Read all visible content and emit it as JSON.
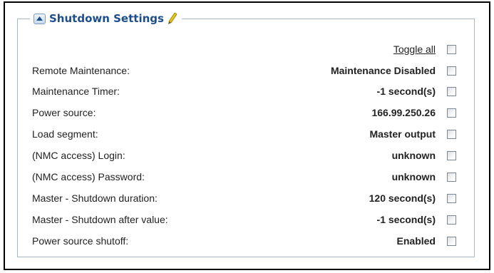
{
  "panel": {
    "title": "Shutdown Settings",
    "collapse_icon": "triangle-up-icon",
    "edit_icon": "pencil-icon"
  },
  "toggle_all_label": "Toggle all",
  "settings": [
    {
      "label": "Remote Maintenance:",
      "value": "Maintenance Disabled"
    },
    {
      "label": "Maintenance Timer:",
      "value": "-1 second(s)"
    },
    {
      "label": "Power source:",
      "value": "166.99.250.26"
    },
    {
      "label": "Load segment:",
      "value": "Master output"
    },
    {
      "label": "(NMC access) Login:",
      "value": "unknown"
    },
    {
      "label": "(NMC access) Password:",
      "value": "unknown"
    },
    {
      "label": "Master - Shutdown duration:",
      "value": "120 second(s)"
    },
    {
      "label": "Master - Shutdown after value:",
      "value": "-1 second(s)"
    },
    {
      "label": "Power source shutoff:",
      "value": "Enabled"
    }
  ],
  "colors": {
    "title": "#1c4e8c",
    "border": "#a9b7c6",
    "pencil": "#d4b000"
  }
}
